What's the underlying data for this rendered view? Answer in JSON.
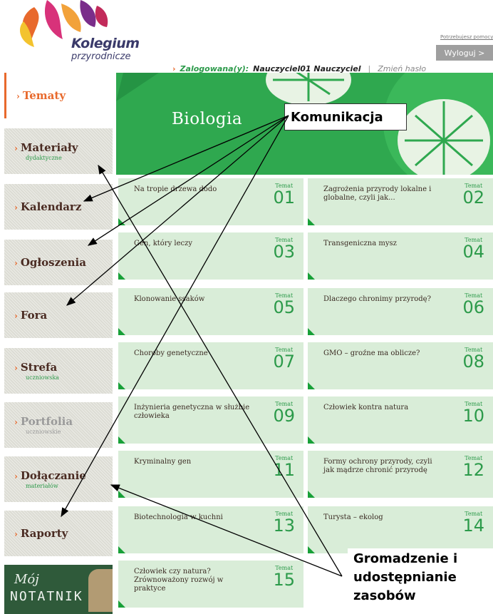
{
  "header": {
    "logo_line1": "Kolegium",
    "logo_line2": "przyrodnicze",
    "login_label": "Zalogowana(y):",
    "user_name": "Nauczyciel01 Nauczyciel",
    "change_password": "Zmień hasło",
    "help_link": "Potrzebujesz pomocy?",
    "logout": "Wyloguj >"
  },
  "sidebar": {
    "items": [
      {
        "label": "Tematy",
        "sub": ""
      },
      {
        "label": "Materiały",
        "sub": "dydaktyczne"
      },
      {
        "label": "Kalendarz",
        "sub": ""
      },
      {
        "label": "Ogłoszenia",
        "sub": ""
      },
      {
        "label": "Fora",
        "sub": ""
      },
      {
        "label": "Strefa",
        "sub": "uczniowska"
      },
      {
        "label": "Portfolia",
        "sub": "uczniowskie"
      },
      {
        "label": "Dołączanie",
        "sub": "materiałów"
      },
      {
        "label": "Raporty",
        "sub": ""
      }
    ],
    "notatnik_line1": "Mój",
    "notatnik_line2": "NOTATNIK"
  },
  "banner": {
    "title": "Biologia"
  },
  "temat_label": "Temat",
  "topics": [
    {
      "title": "Na tropie drzewa dodo",
      "number": "01"
    },
    {
      "title": "Zagrożenia przyrody lokalne i globalne, czyli jak...",
      "number": "02"
    },
    {
      "title": "Gen, który leczy",
      "number": "03"
    },
    {
      "title": "Transgeniczna mysz",
      "number": "04"
    },
    {
      "title": "Klonowanie ssaków",
      "number": "05"
    },
    {
      "title": "Dlaczego chronimy przyrodę?",
      "number": "06"
    },
    {
      "title": "Choroby genetyczne",
      "number": "07"
    },
    {
      "title": "GMO – groźne ma oblicze?",
      "number": "08"
    },
    {
      "title": "Inżynieria genetyczna w służbie człowieka",
      "number": "09"
    },
    {
      "title": "Człowiek kontra natura",
      "number": "10"
    },
    {
      "title": "Kryminalny gen",
      "number": "11"
    },
    {
      "title": "Formy ochrony przyrody, czyli jak mądrze chronić przyrodę",
      "number": "12"
    },
    {
      "title": "Biotechnologia w kuchni",
      "number": "13"
    },
    {
      "title": "Turysta – ekolog",
      "number": "14"
    },
    {
      "title": "Człowiek czy natura? Zrównoważony rozwój w praktyce",
      "number": "15"
    }
  ],
  "annotations": {
    "komunikacja": "Komunikacja",
    "gromadzenie_1": "Gromadzenie i",
    "gromadzenie_2": "udostępnianie",
    "gromadzenie_3": "zasobów"
  },
  "colors": {
    "accent_orange": "#e8692c",
    "brand_green": "#2fa84f",
    "tile_green": "#d9edd8",
    "text_brown": "#4a2b22"
  }
}
